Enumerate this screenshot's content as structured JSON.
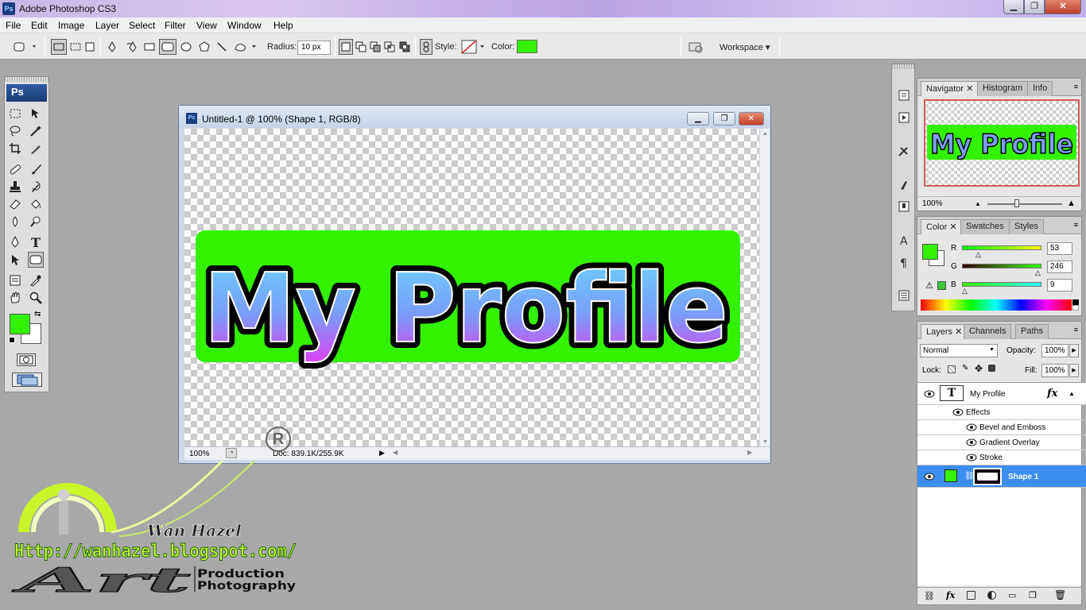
{
  "app": {
    "title": "Adobe Photoshop CS3",
    "icon_label": "Ps"
  },
  "window_controls": {
    "minimize": "▁",
    "maximize": "❐",
    "close": "✕"
  },
  "menu": [
    "File",
    "Edit",
    "Image",
    "Layer",
    "Select",
    "Filter",
    "View",
    "Window",
    "Help"
  ],
  "options_bar": {
    "radius_label": "Radius:",
    "radius_value": "10 px",
    "style_label": "Style:",
    "color_label": "Color:",
    "color_value": "#33f200",
    "workspace_label": "Workspace ▾"
  },
  "toolbox": {
    "header": "Ps",
    "foreground_color": "#33f200",
    "background_color": "#ffffff"
  },
  "document": {
    "title": "Untitled-1 @ 100% (Shape 1, RGB/8)",
    "icon_label": "Ps",
    "canvas_text": "My Profile",
    "zoom": "100%",
    "doc_info": "Doc: 839.1K/255.9K"
  },
  "navigator": {
    "tabs": [
      "Navigator",
      "Histogram",
      "Info"
    ],
    "zoom": "100%",
    "thumb_text": "My Profile"
  },
  "color_panel": {
    "tabs": [
      "Color",
      "Swatches",
      "Styles"
    ],
    "channels": [
      {
        "label": "R",
        "value": "53",
        "level": 0.21
      },
      {
        "label": "G",
        "value": "246",
        "level": 0.96
      },
      {
        "label": "B",
        "value": "9",
        "level": 0.04
      }
    ],
    "current": "#35f609"
  },
  "layers_panel": {
    "tabs": [
      "Layers",
      "Channels",
      "Paths"
    ],
    "blend_mode": "Normal",
    "opacity_label": "Opacity:",
    "opacity_value": "100%",
    "lock_label": "Lock:",
    "fill_label": "Fill:",
    "fill_value": "100%",
    "layers": [
      {
        "name": "My Profile",
        "thumb": "T",
        "fx": "fx"
      },
      {
        "name": "Effects"
      },
      {
        "name": "Bevel and Emboss"
      },
      {
        "name": "Gradient Overlay"
      },
      {
        "name": "Stroke"
      },
      {
        "name": "Shape 1",
        "selected": true
      }
    ]
  },
  "watermark": {
    "name": "Wan Hazel",
    "url": "Http://wanhazel.blogspot.com/",
    "art": "Art",
    "line1": "Production",
    "line2": "Photography"
  },
  "stamp": "R",
  "colors": {
    "accent_green": "#33f200",
    "selection_blue": "#3b8ff2",
    "text_gradient_top": "#6ad4ff",
    "text_gradient_bottom": "#e13cf0"
  }
}
